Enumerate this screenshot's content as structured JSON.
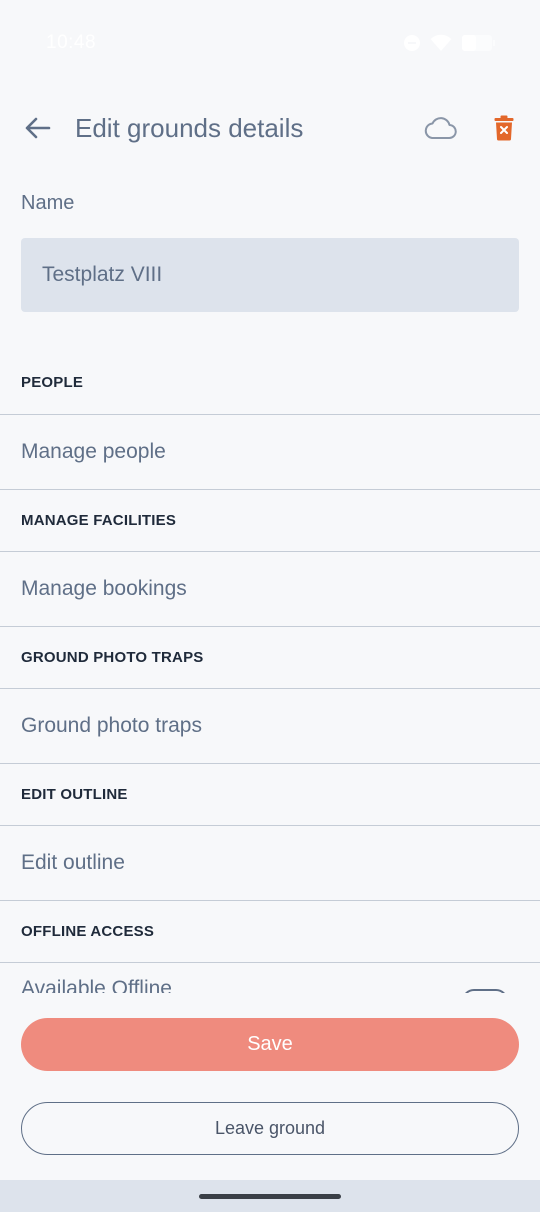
{
  "status_bar": {
    "time": "10:48"
  },
  "app_bar": {
    "title": "Edit grounds details",
    "icons": {
      "back": "arrow-left-icon",
      "cloud": "cloud-icon",
      "delete": "trash-icon"
    },
    "delete_color": "#e3672a"
  },
  "name_field": {
    "label": "Name",
    "value": "Testplatz VIII"
  },
  "sections": [
    {
      "header": "PEOPLE",
      "item": "Manage people"
    },
    {
      "header": "MANAGE FACILITIES",
      "item": "Manage bookings"
    },
    {
      "header": "GROUND PHOTO TRAPS",
      "item": "Ground photo traps"
    },
    {
      "header": "EDIT OUTLINE",
      "item": "Edit outline"
    },
    {
      "header": "OFFLINE ACCESS",
      "item": "Available Offline"
    }
  ],
  "actions": {
    "save": "Save",
    "leave": "Leave ground"
  },
  "colors": {
    "primary": "#ef8b7e",
    "text": "#5f6f87",
    "input_bg": "#dde3ec"
  }
}
